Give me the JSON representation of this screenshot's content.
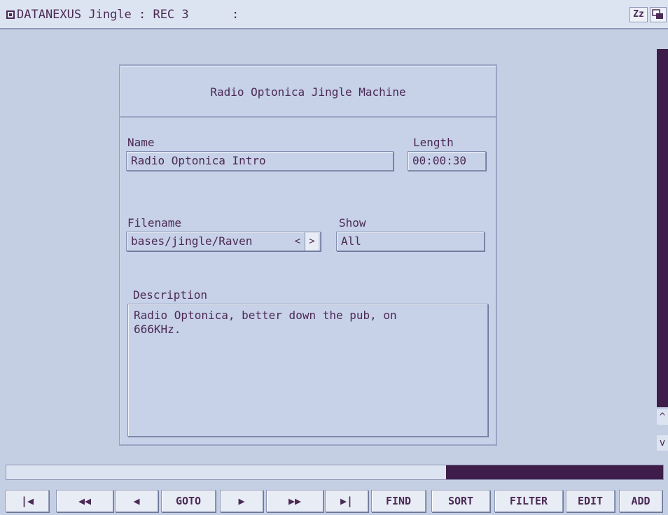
{
  "window": {
    "title": "DATANEXUS Jingle : REC 3      :",
    "zoom_label": "Zz",
    "depth_icon": "depth-gadget-icon"
  },
  "form": {
    "heading": "Radio Optonica Jingle Machine",
    "name_label": "Name",
    "name_value": "Radio Optonica Intro",
    "length_label": "Length",
    "length_value": "00:00:30",
    "filename_label": "Filename",
    "filename_value": "bases/jingle/Raven",
    "file_prev": "<",
    "file_next": ">",
    "show_label": "Show",
    "show_value": "All",
    "description_label": "Description",
    "description_value": "Radio Optonica, better down the pub, on\n666KHz."
  },
  "scrollbar": {
    "up": "^",
    "down": "v"
  },
  "status": {
    "progress_fraction": 0.33
  },
  "toolbar": {
    "first": "|◀",
    "rewind": "◀◀",
    "prev": "◀",
    "goto": "GOTO",
    "next": "▶",
    "forward": "▶▶",
    "last": "▶|",
    "find": "FIND",
    "sort": "SORT",
    "filter": "FILTER",
    "edit": "EDIT",
    "add": "ADD"
  },
  "colors": {
    "background": "#c4cfe4",
    "text": "#4b2a55",
    "accent": "#3e1d4a"
  }
}
